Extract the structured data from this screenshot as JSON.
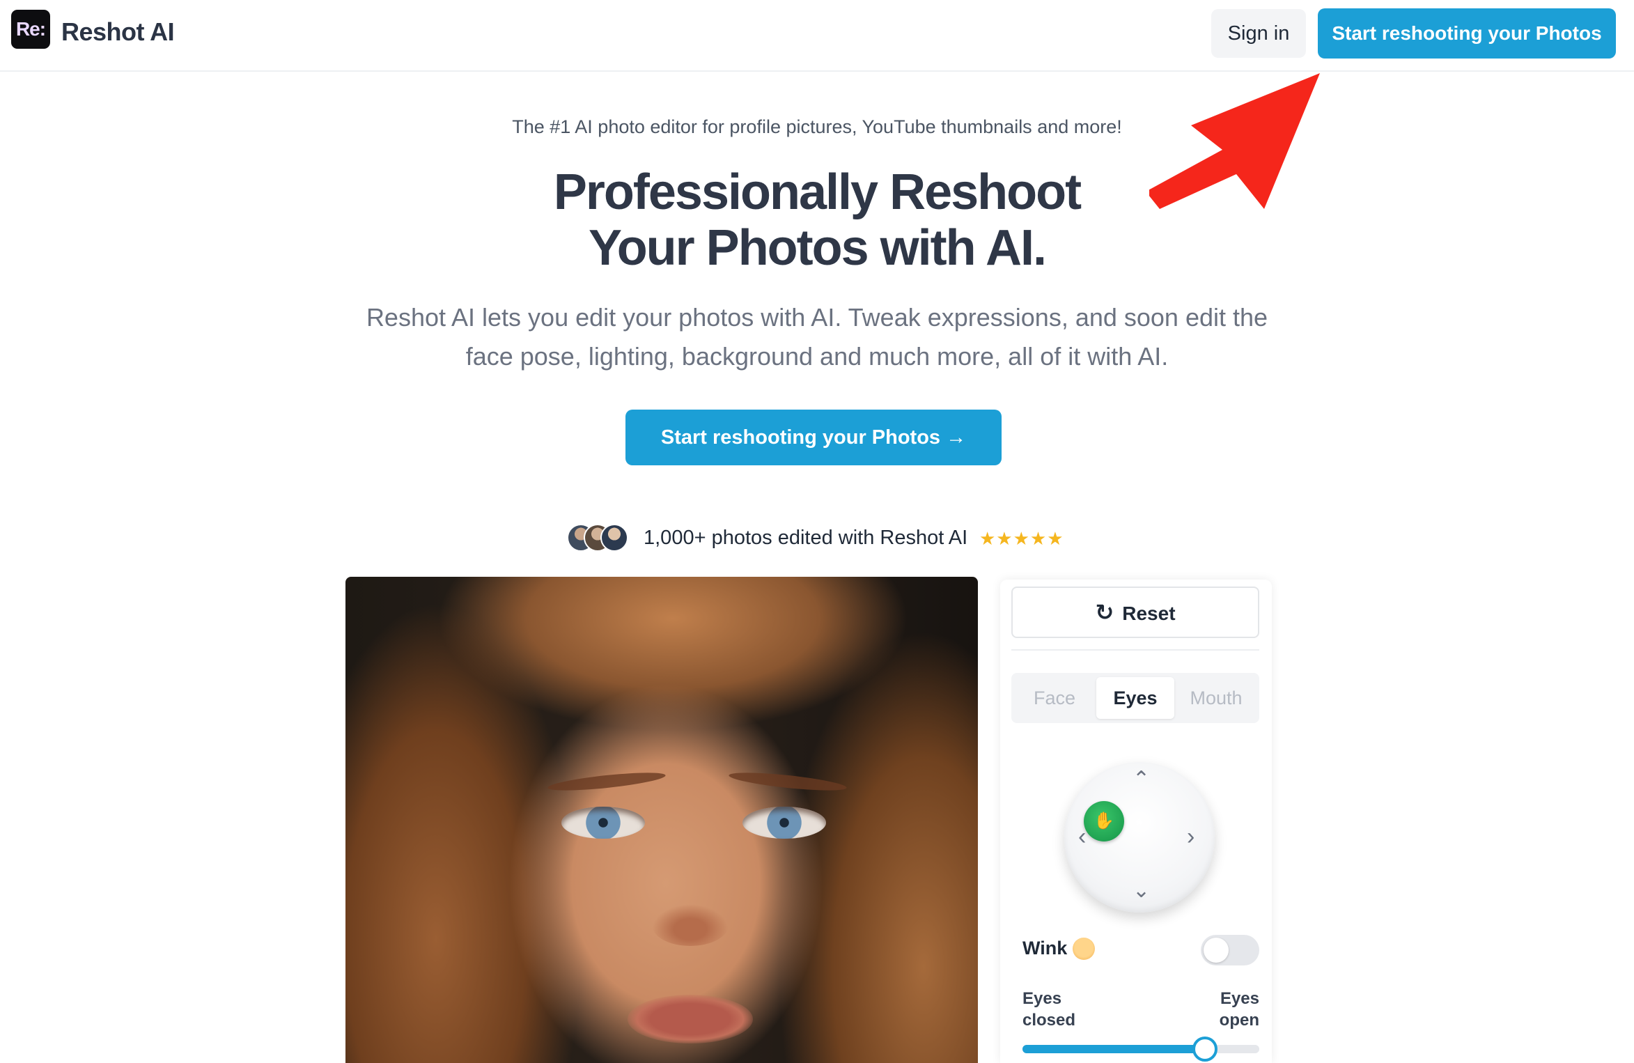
{
  "header": {
    "logo_text": "Re:",
    "brand": "Reshot AI",
    "signin_label": "Sign in",
    "cta_label": "Start reshooting your Photos"
  },
  "hero": {
    "tagline": "The #1 AI photo editor for profile pictures, YouTube thumbnails and more!",
    "headline_line1": "Professionally Reshoot",
    "headline_line2": "Your Photos with AI.",
    "subhead_line1": "Reshot AI lets you edit your photos with AI. Tweak expressions, and soon edit the",
    "subhead_line2": "face pose, lighting, background and much more, all of it with AI.",
    "cta_label": "Start reshooting your Photos →"
  },
  "proof": {
    "text": "1,000+ photos edited with Reshot AI",
    "stars": "★★★★★",
    "rating": 5
  },
  "editor": {
    "reset_label": "Reset",
    "tabs": [
      {
        "label": "Face",
        "active": false
      },
      {
        "label": "Eyes",
        "active": true
      },
      {
        "label": "Mouth",
        "active": false
      }
    ],
    "wink_label": "Wink",
    "wink_on": false,
    "range_left_line1": "Eyes",
    "range_left_line2": "closed",
    "range_right_line1": "Eyes",
    "range_right_line2": "open",
    "eyes_open_level": 0.77
  },
  "colors": {
    "accent": "#1c9fd6",
    "annotation_arrow": "#f5261b",
    "knob": "#20a352",
    "stars": "#f5b61f"
  },
  "icons": {
    "reset": "refresh-icon",
    "knob": "hand-grab-icon",
    "arrow": "red-arrow-annotation"
  }
}
